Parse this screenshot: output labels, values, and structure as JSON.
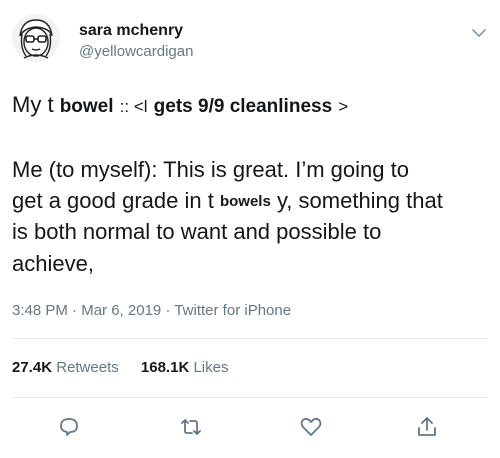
{
  "user": {
    "name": "sara mchenry",
    "handle": "@yellowcardigan",
    "avatar_icon": "cartoon-girl-with-glasses-avatar"
  },
  "tweet": {
    "line1_prefix": "My t",
    "line1_bold1": "bowel",
    "line1_mid": ":: <l",
    "line1_bold2": "gets 9/9 cleanliness",
    "line1_suffix": ">",
    "line2": "Me (to myself): This is great. I’m going to",
    "line3_prefix": "get a good grade in t",
    "line3_bold": "bowels",
    "line3_suffix": "y, something that",
    "line4": "is both normal to want and possible to",
    "line5": "achieve,"
  },
  "meta": {
    "time": "3:48 PM",
    "sep1": "·",
    "date": "Mar 6, 2019",
    "sep2": "·",
    "source": "Twitter for iPhone"
  },
  "stats": {
    "retweets_count": "27.4K",
    "retweets_label": "Retweets",
    "likes_count": "168.1K",
    "likes_label": "Likes"
  },
  "actions": {
    "reply_icon": "reply-icon",
    "retweet_icon": "retweet-icon",
    "like_icon": "heart-icon",
    "share_icon": "share-icon"
  },
  "colors": {
    "text": "#14171a",
    "secondary": "#657786",
    "divider": "#e6ecf0"
  }
}
